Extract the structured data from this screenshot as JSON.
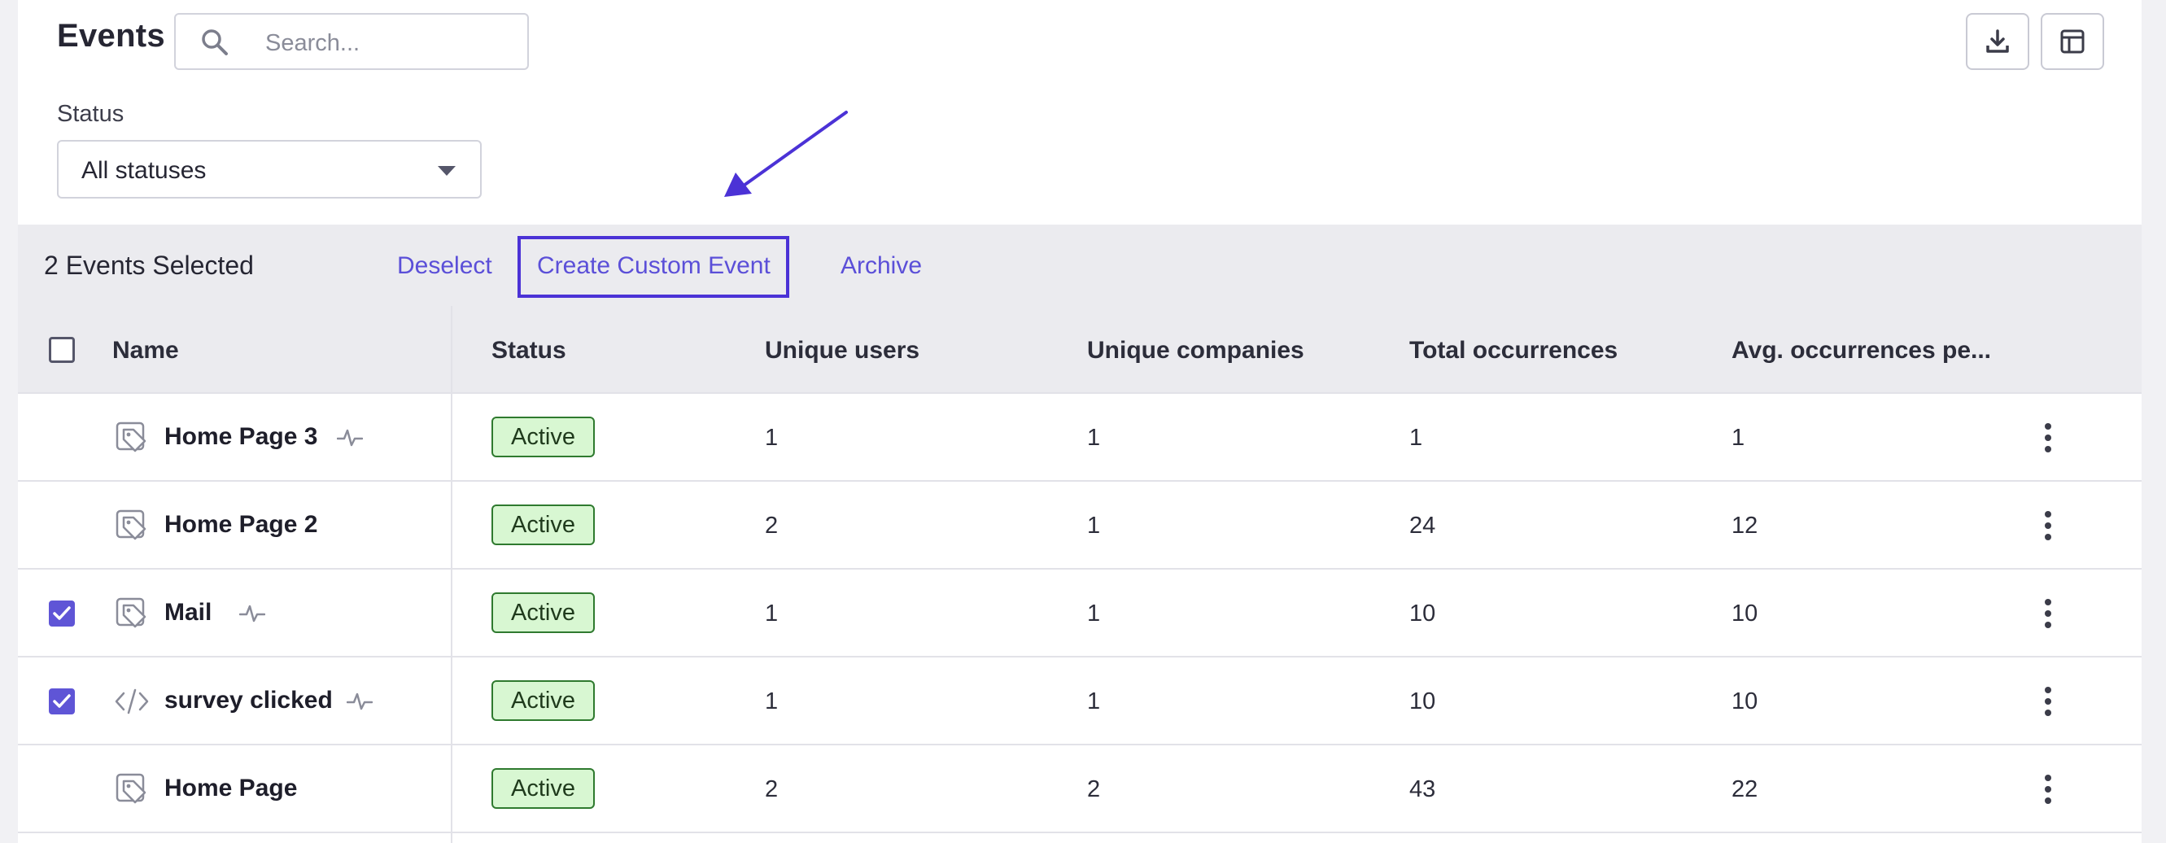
{
  "header": {
    "title": "Events",
    "search_placeholder": "Search...",
    "download_icon": "download-icon",
    "columns_icon": "table-columns-icon"
  },
  "filters": {
    "status_label": "Status",
    "status_value": "All statuses"
  },
  "selection_bar": {
    "count_text": "2 Events Selected",
    "deselect_label": "Deselect",
    "create_custom_label": "Create Custom Event",
    "archive_label": "Archive"
  },
  "table": {
    "columns": [
      "Name",
      "Status",
      "Unique users",
      "Unique companies",
      "Total occurrences",
      "Avg. occurrences pe..."
    ],
    "rows": [
      {
        "name": "Home Page 3",
        "checked": false,
        "icon": "tag-icon",
        "pulse": true,
        "status": "Active",
        "unique_users": "1",
        "unique_companies": "1",
        "total": "1",
        "avg": "1"
      },
      {
        "name": "Home Page 2",
        "checked": false,
        "icon": "tag-icon",
        "pulse": false,
        "status": "Active",
        "unique_users": "2",
        "unique_companies": "1",
        "total": "24",
        "avg": "12"
      },
      {
        "name": "Mail",
        "checked": true,
        "icon": "tag-icon",
        "pulse": true,
        "status": "Active",
        "unique_users": "1",
        "unique_companies": "1",
        "total": "10",
        "avg": "10"
      },
      {
        "name": "survey clicked",
        "checked": true,
        "icon": "code-icon",
        "pulse": true,
        "status": "Active",
        "unique_users": "1",
        "unique_companies": "1",
        "total": "10",
        "avg": "10"
      },
      {
        "name": "Home Page",
        "checked": false,
        "icon": "tag-icon",
        "pulse": false,
        "status": "Active",
        "unique_users": "2",
        "unique_companies": "2",
        "total": "43",
        "avg": "22"
      }
    ]
  },
  "colors": {
    "accent": "#5b4fd8",
    "highlight": "#4b32d6",
    "active_badge_bg": "#d8f7d2",
    "active_badge_border": "#2f7a2f"
  }
}
